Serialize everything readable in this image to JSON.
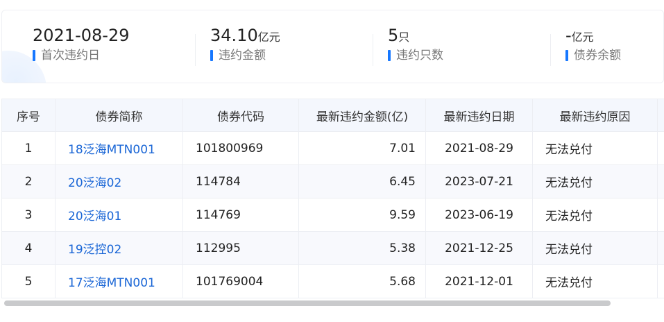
{
  "summary": {
    "first_default": {
      "value": "2021-08-29",
      "unit": "",
      "label": "首次违约日"
    },
    "default_amount": {
      "value": "34.10",
      "unit": "亿元",
      "label": "违约金额"
    },
    "default_count": {
      "value": "5",
      "unit": "只",
      "label": "违约只数"
    },
    "bond_balance": {
      "value": "-",
      "unit": "亿元",
      "label": "债券余额"
    }
  },
  "table": {
    "headers": [
      "序号",
      "债券简称",
      "债券代码",
      "最新违约金额(亿)",
      "最新违约日期",
      "最新违约原因"
    ],
    "rows": [
      {
        "index": "1",
        "name": "18泛海MTN001",
        "code": "101800969",
        "amount": "7.01",
        "date": "2021-08-29",
        "reason": "无法兑付"
      },
      {
        "index": "2",
        "name": "20泛海02",
        "code": "114784",
        "amount": "6.45",
        "date": "2023-07-21",
        "reason": "无法兑付"
      },
      {
        "index": "3",
        "name": "20泛海01",
        "code": "114769",
        "amount": "9.59",
        "date": "2023-06-19",
        "reason": "无法兑付"
      },
      {
        "index": "4",
        "name": "19泛控02",
        "code": "112995",
        "amount": "5.38",
        "date": "2021-12-25",
        "reason": "无法兑付"
      },
      {
        "index": "5",
        "name": "17泛海MTN001",
        "code": "101769004",
        "amount": "5.68",
        "date": "2021-12-01",
        "reason": "无法兑付"
      }
    ]
  },
  "colors": {
    "accent": "#1677ff",
    "link": "#1a66d6",
    "header_bg": "#f4f7fd"
  }
}
